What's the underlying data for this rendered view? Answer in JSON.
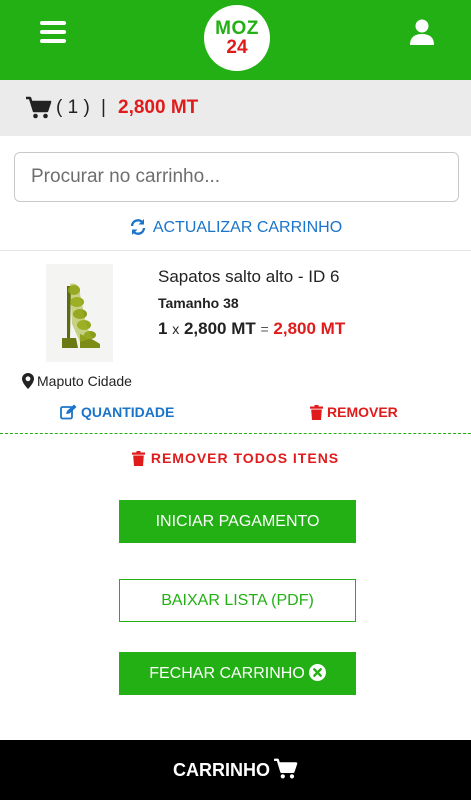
{
  "header": {
    "logo_line1": "MOZ",
    "logo_line2": "24",
    "menu_icon": "hamburger-menu-icon",
    "user_icon": "user-icon"
  },
  "summary": {
    "count": "( 1 )",
    "separator": "|",
    "total": "2,800 MT"
  },
  "search": {
    "placeholder": "Procurar no carrinho..."
  },
  "refresh_label": "ACTUALIZAR CARRINHO",
  "item": {
    "name": "Sapatos salto alto - ID 6",
    "size": "Tamanho 38",
    "quantity": "1",
    "times": "x",
    "unit_price": "2,800 MT",
    "equals": "=",
    "subtotal": "2,800 MT",
    "location": "Maputo Cidade",
    "image_alt": "green high heel shoe"
  },
  "actions": {
    "quantity_label": "QUANTIDADE",
    "remove_label": "REMOVER",
    "remove_all_label": "REMOVER TODOS ITENS"
  },
  "buttons": {
    "pay": "INICIAR PAGAMENTO",
    "pdf": "BAIXAR LISTA (PDF)",
    "close": "FECHAR CARRINHO"
  },
  "footer": {
    "label": "CARRINHO"
  },
  "colors": {
    "brand_green": "#22b014",
    "accent_red": "#e01b1b",
    "link_blue": "#1a74c9"
  }
}
